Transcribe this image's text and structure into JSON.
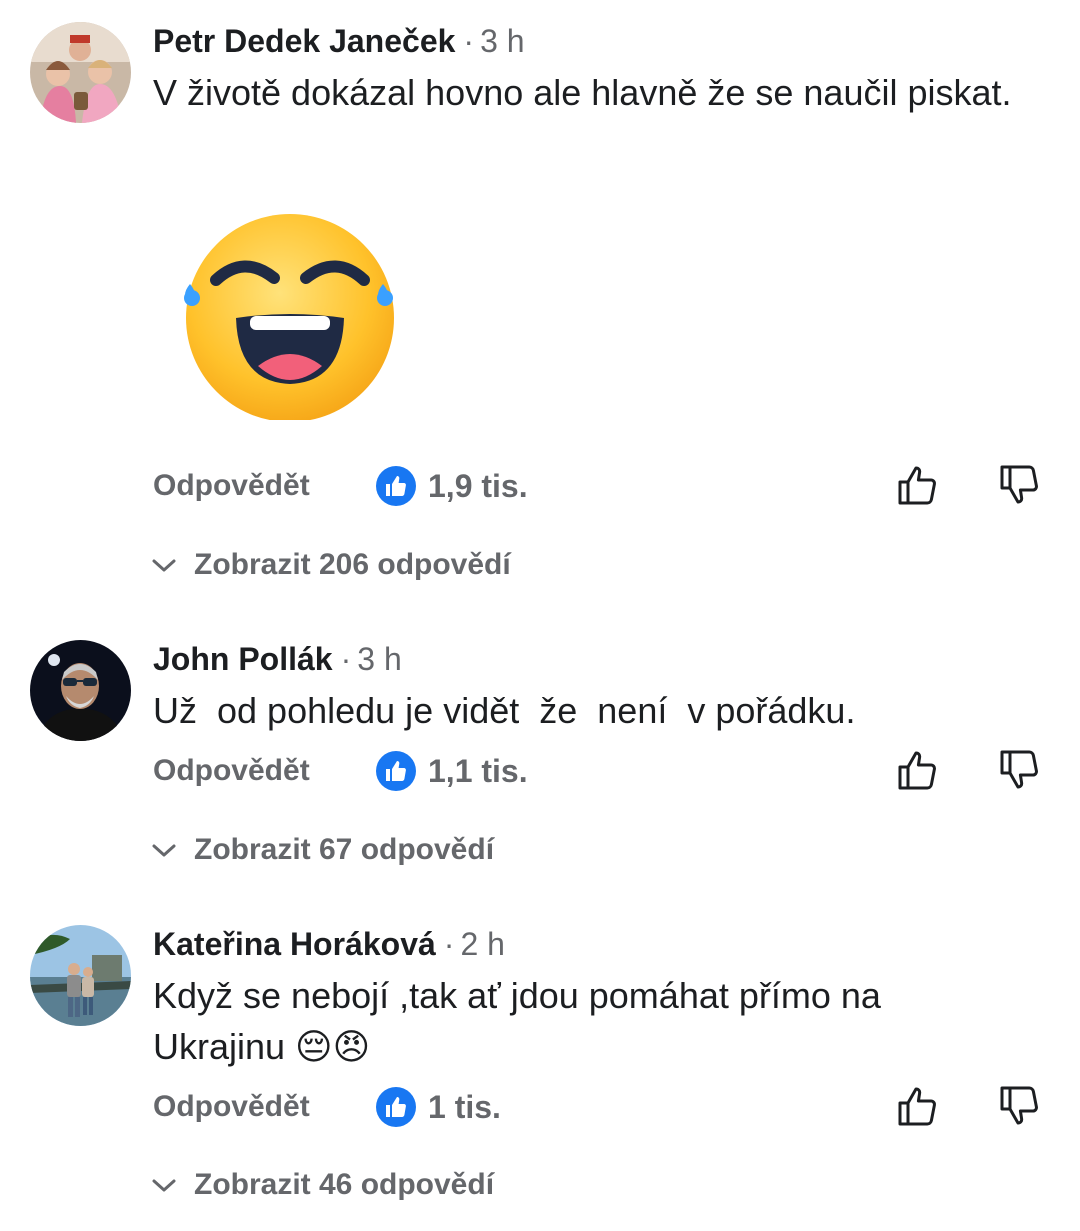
{
  "comments": [
    {
      "author": "Petr Dedek Janeček",
      "separator": "·",
      "time": "3 h",
      "text": "V životě dokázal hovno ale hlavně že se naučil piskat.",
      "sticker": "laughing-tears-emoji",
      "reply_label": "Odpovědět",
      "like_count": "1,9 tis.",
      "replies_label": "Zobrazit 206 odpovědí"
    },
    {
      "author": "John Pollák",
      "separator": "·",
      "time": "3 h",
      "text": "Už  od pohledu je vidět  že  není  v pořádku.",
      "reply_label": "Odpovědět",
      "like_count": "1,1 tis.",
      "replies_label": "Zobrazit 67 odpovědí"
    },
    {
      "author": "Kateřina Horáková",
      "separator": "·",
      "time": "2 h",
      "text": "Když se nebojí ,tak ať jdou pomáhat přímo na Ukrajinu 😔😠",
      "reply_label": "Odpovědět",
      "like_count": "1 tis.",
      "replies_label": "Zobrazit 46 odpovědí"
    }
  ],
  "icons": {
    "like_badge": "thumbs-up-icon",
    "vote_up": "thumbs-up-outline-icon",
    "vote_down": "thumbs-down-outline-icon",
    "expand": "chevron-down-icon"
  },
  "colors": {
    "like_blue": "#1877f2",
    "muted_text": "#65676b",
    "primary_text": "#1c1e21"
  }
}
